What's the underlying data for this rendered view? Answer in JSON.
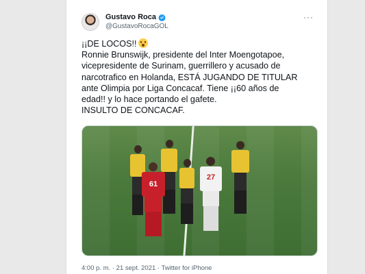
{
  "tweet": {
    "author_name": "Gustavo Roca",
    "author_handle": "@GustavoRocaGOL",
    "more_label": "···",
    "text_lines": [
      "¡¡DE LOCOS!!",
      "Ronnie Brunswijk, presidente del Inter Moengotapoe,",
      "vicepresidente de Surinam, guerrillero y acusado de",
      "narcotrafico en Holanda, ESTÁ JUGANDO DE TITULAR",
      "ante Olimpia por Liga Concacaf. Tiene ¡¡60 años de",
      "edad!! y lo hace portando el gafete.",
      "INSULTO DE CONCACAF."
    ],
    "emoji_icon": "astonished-face-emoji",
    "media_icon": "football-match-photo",
    "timestamp": "4:00 p. m. · 21 sept. 2021 · Twitter for iPhone",
    "verified_color": "#1d9bf0"
  }
}
